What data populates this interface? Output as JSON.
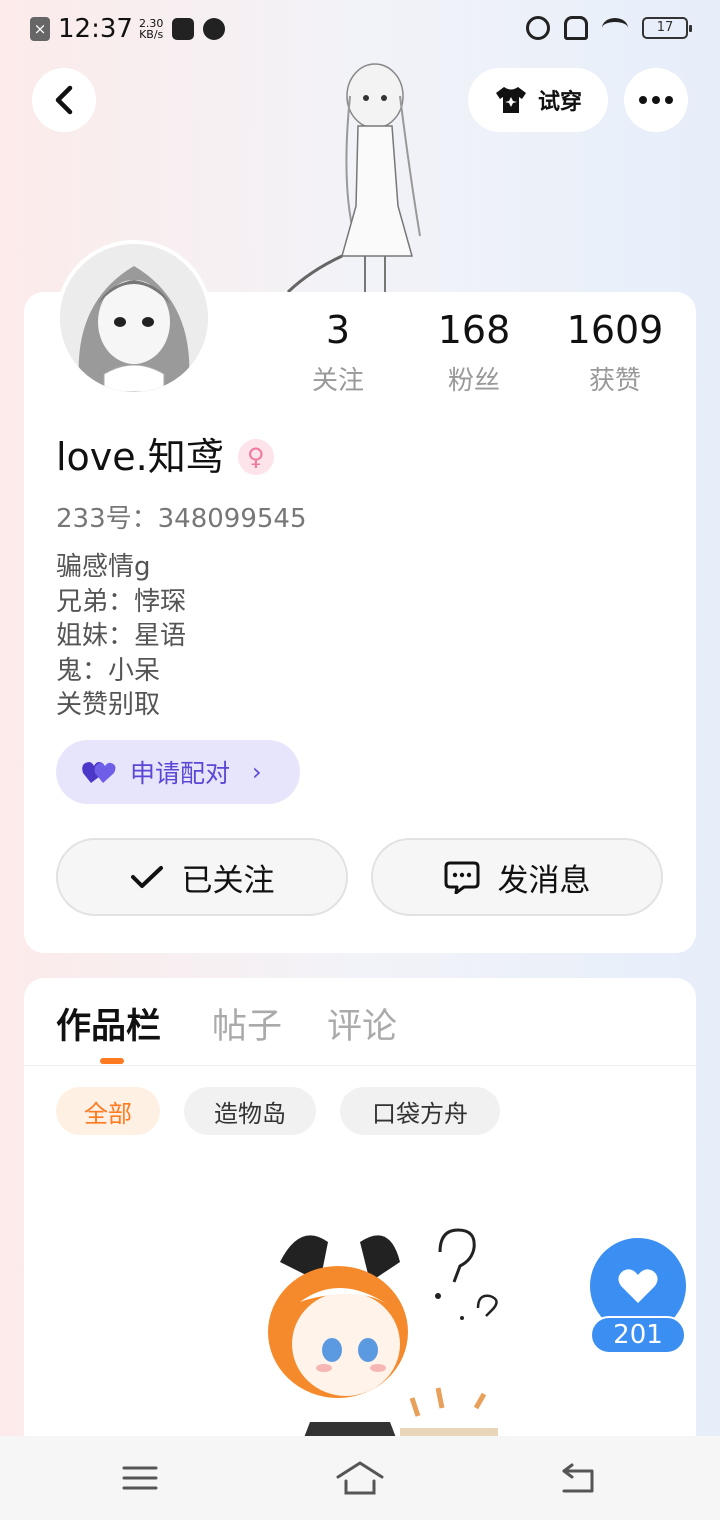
{
  "status_bar": {
    "time": "12:37",
    "speed_value": "2.30",
    "speed_unit": "KB/s",
    "battery": "17"
  },
  "header": {
    "try_on_label": "试穿"
  },
  "stats": [
    {
      "num": "3",
      "label": "关注"
    },
    {
      "num": "168",
      "label": "粉丝"
    },
    {
      "num": "1609",
      "label": "获赞"
    }
  ],
  "profile": {
    "name": "love.知鸢",
    "gender_symbol": "♀",
    "uid": "233号：348099545",
    "bio": [
      "骗感情g",
      "兄弟：悖琛",
      "姐妹：星语",
      "鬼：小呆",
      "关赞别取"
    ]
  },
  "pair": {
    "label": "申请配对",
    "heart_icon": "purple-hearts-icon"
  },
  "actions": {
    "followed_label": "已关注",
    "message_label": "发消息"
  },
  "tabs": [
    "作品栏",
    "帖子",
    "评论"
  ],
  "chips": [
    "全部",
    "造物岛",
    "口袋方舟"
  ],
  "like": {
    "count": "201"
  },
  "colors": {
    "accent_orange": "#ff7a20",
    "pair_purple": "#5b47d6",
    "like_blue": "#3b8ff2"
  }
}
